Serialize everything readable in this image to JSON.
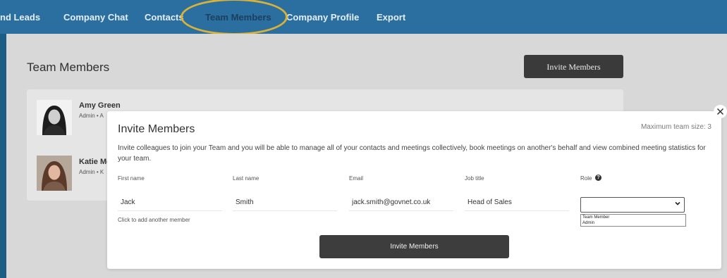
{
  "nav": {
    "items": [
      {
        "label": "nd Leads"
      },
      {
        "label": "Company Chat"
      },
      {
        "label": "Contacts"
      },
      {
        "label": "Team Members"
      },
      {
        "label": "Company Profile"
      },
      {
        "label": "Export"
      }
    ]
  },
  "page": {
    "title": "Team Members",
    "invite_button": "Invite Members"
  },
  "members": [
    {
      "name": "Amy Green",
      "role": "Admin  •  A"
    },
    {
      "name": "Katie Mc",
      "role": "Admin  •  K"
    }
  ],
  "modal": {
    "title": "Invite Members",
    "max_team": "Maximum team size: 3",
    "description": "Invite colleagues to join your Team and you will be able to manage all of your contacts and meetings collectively, book meetings on another's behalf and view combined meeting statistics for your team.",
    "fields": {
      "first_name": {
        "label": "First name",
        "value": "Jack"
      },
      "last_name": {
        "label": "Last name",
        "value": "Smith"
      },
      "email": {
        "label": "Email",
        "value": "jack.smith@govnet.co.uk"
      },
      "job_title": {
        "label": "Job title",
        "value": "Head of Sales"
      },
      "role": {
        "label": "Role",
        "value": "",
        "options": [
          "Team Member",
          "Admin"
        ]
      }
    },
    "add_another": "Click to add another member",
    "submit": "Invite Members"
  },
  "icons": {
    "help": "?",
    "close": "close-icon",
    "chevron": "chevron-down-icon"
  },
  "colors": {
    "nav_bg": "#2a6f9f",
    "page_bg": "#d8d8d8",
    "button_dark": "#3a3a3a",
    "highlight": "#d8b13a"
  }
}
